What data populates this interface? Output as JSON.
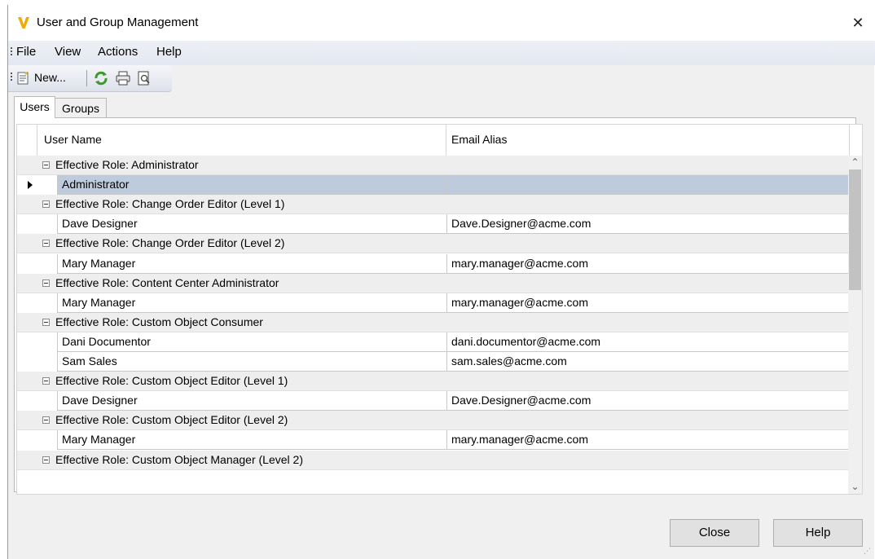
{
  "window": {
    "title": "User and Group Management",
    "close_glyph": "✕"
  },
  "menubar": {
    "items": [
      "File",
      "View",
      "Actions",
      "Help"
    ]
  },
  "toolbar": {
    "new_label": "New...",
    "icons": [
      "new-document-icon",
      "refresh-icon",
      "print-icon",
      "print-preview-icon"
    ]
  },
  "tabs": [
    {
      "label": "Users",
      "active": true
    },
    {
      "label": "Groups",
      "active": false
    }
  ],
  "grid": {
    "columns": [
      "User Name",
      "Email Alias"
    ],
    "rows": [
      {
        "type": "group",
        "label": "Effective Role: Administrator"
      },
      {
        "type": "data",
        "user": "Administrator",
        "email": "",
        "selected": true
      },
      {
        "type": "group",
        "label": "Effective Role: Change Order Editor (Level 1)"
      },
      {
        "type": "data",
        "user": "Dave Designer",
        "email": "Dave.Designer@acme.com"
      },
      {
        "type": "group",
        "label": "Effective Role: Change Order Editor (Level 2)"
      },
      {
        "type": "data",
        "user": "Mary Manager",
        "email": "mary.manager@acme.com"
      },
      {
        "type": "group",
        "label": "Effective Role: Content Center Administrator"
      },
      {
        "type": "data",
        "user": "Mary Manager",
        "email": "mary.manager@acme.com"
      },
      {
        "type": "group",
        "label": "Effective Role: Custom Object Consumer"
      },
      {
        "type": "data",
        "user": "Dani Documentor",
        "email": "dani.documentor@acme.com"
      },
      {
        "type": "data",
        "user": "Sam Sales",
        "email": "sam.sales@acme.com"
      },
      {
        "type": "group",
        "label": "Effective Role: Custom Object Editor (Level 1)"
      },
      {
        "type": "data",
        "user": "Dave Designer",
        "email": "Dave.Designer@acme.com"
      },
      {
        "type": "group",
        "label": "Effective Role: Custom Object Editor (Level 2)"
      },
      {
        "type": "data",
        "user": "Mary Manager",
        "email": "mary.manager@acme.com"
      },
      {
        "type": "group",
        "label": "Effective Role: Custom Object Manager (Level 2)"
      }
    ]
  },
  "buttons": {
    "close_label": "Close",
    "help_label": "Help"
  },
  "colors": {
    "selected_row": "#bdcbdc",
    "group_row": "#eeeeee",
    "app_icon": "#f2a900",
    "refresh_icon": "#3a9a2a"
  }
}
